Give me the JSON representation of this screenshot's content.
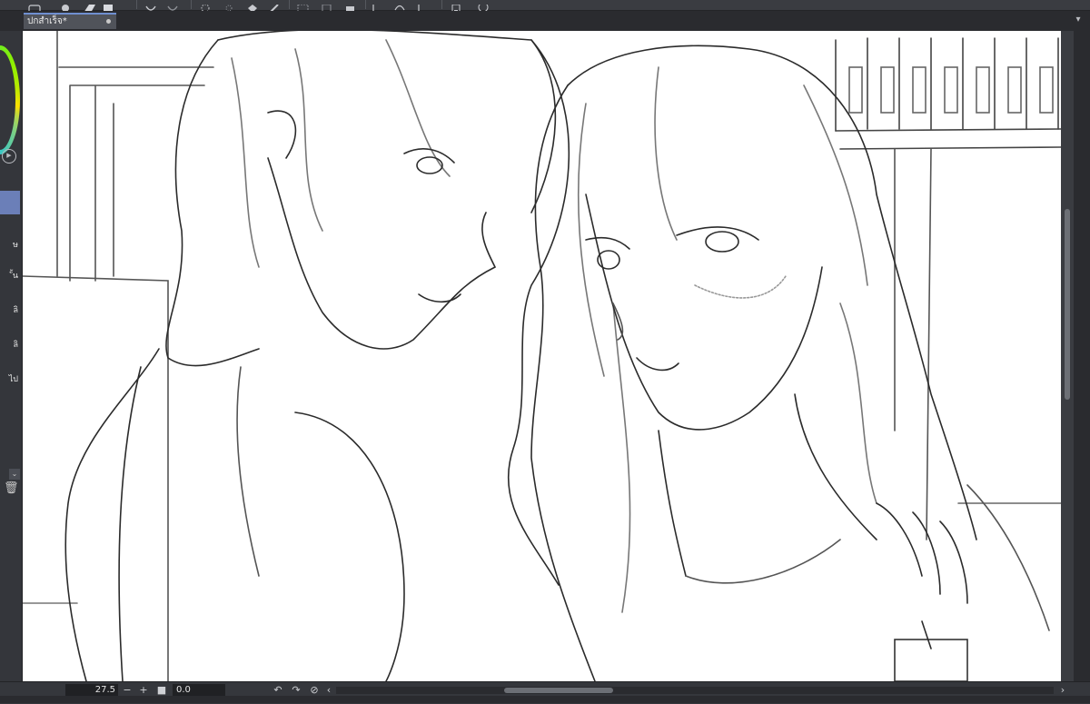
{
  "document": {
    "tab_title": "ปกสำเร็จ*"
  },
  "toolbar": {
    "icons": [
      "camera-icon",
      "new-layer-icon",
      "eraser-icon",
      "undo-icon",
      "spinner-icon",
      "brush-icon",
      "crop-icon",
      "lock-icon",
      "ruler-icon",
      "mobile-icon",
      "speech-icon"
    ]
  },
  "left_panel": {
    "items": [
      "ษ",
      "ั้น",
      "ลิ",
      "ลิ",
      "ไป"
    ]
  },
  "status": {
    "zoom": "27.5",
    "zoom_minus": "−",
    "zoom_plus": "+",
    "rotation": "0.0"
  },
  "colors": {
    "ui_dark": "#2f3136",
    "tab_accent": "#6f8fd0",
    "selection": "#6b7fb8",
    "canvas": "#ffffff"
  }
}
